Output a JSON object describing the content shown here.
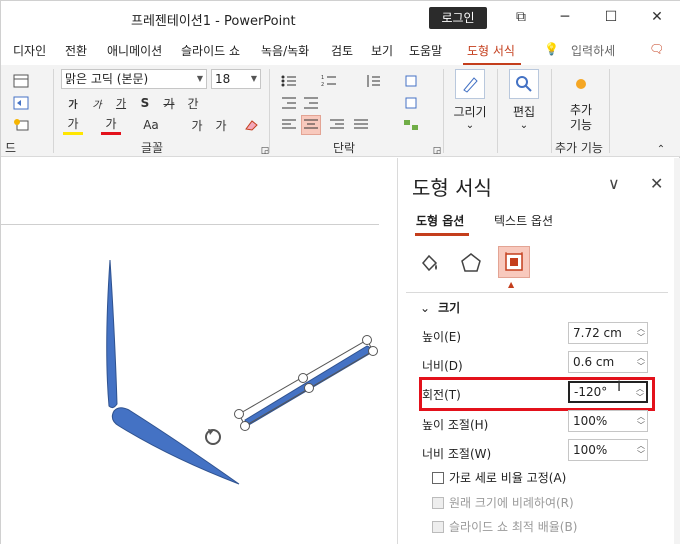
{
  "window": {
    "title": "프레젠테이션1  -  PowerPoint",
    "login": "로그인",
    "restore_glyph": "⧉",
    "minimize_glyph": "─",
    "maximize_glyph": "☐",
    "close_glyph": "✕"
  },
  "menu": {
    "items": [
      "디자인",
      "전환",
      "애니메이션",
      "슬라이드 쇼",
      "녹음/녹화",
      "검토",
      "보기",
      "도움말",
      "도형 서식"
    ],
    "active": "도형 서식",
    "search": "입력하세",
    "lightbulb_glyph": "💡",
    "comment_glyph": "🗨"
  },
  "ribbon": {
    "font_name": "맑은 고딕 (본문)",
    "font_size": "18",
    "groups": {
      "font": "글꼴",
      "paragraph": "단락",
      "addins": "추가 기능",
      "partial": "드"
    },
    "format_buttons": [
      "가",
      "가",
      "가",
      "S",
      "가",
      "간"
    ],
    "format_row2": [
      "가",
      "가",
      "Aa",
      "가",
      "가"
    ],
    "big_buttons": [
      {
        "label": "그리기"
      },
      {
        "label": "편집"
      },
      {
        "label": "추가\n기능"
      }
    ],
    "chevron": "⌄"
  },
  "pane": {
    "title": "도형 서식",
    "collapse_glyph": "∨",
    "close_glyph": "✕",
    "tabs": [
      "도형 옵션",
      "텍스트 옵션"
    ],
    "active_tab": "도형 옵션",
    "section": "크기",
    "section_toggle": "⌄",
    "fields": [
      {
        "label": "높이(E)",
        "value": "7.72 cm"
      },
      {
        "label": "너비(D)",
        "value": "0.6 cm"
      },
      {
        "label": "회전(T)",
        "value": "-120°"
      },
      {
        "label": "높이 조절(H)",
        "value": "100%"
      },
      {
        "label": "너비 조절(W)",
        "value": "100%"
      }
    ],
    "checkboxes": [
      {
        "label": "가로 세로 비율 고정(A)",
        "disabled": false
      },
      {
        "label": "원래 크기에 비례하여(R)",
        "disabled": true
      },
      {
        "label": "슬라이드 쇼 최적 배율(B)",
        "disabled": true
      }
    ],
    "cursor_glyph": "I"
  },
  "colors": {
    "accent": "#c43e1c",
    "shape_fill": "#4472c4",
    "highlight_box": "#e3111b",
    "ribbon_bg": "#f3f3f3"
  }
}
